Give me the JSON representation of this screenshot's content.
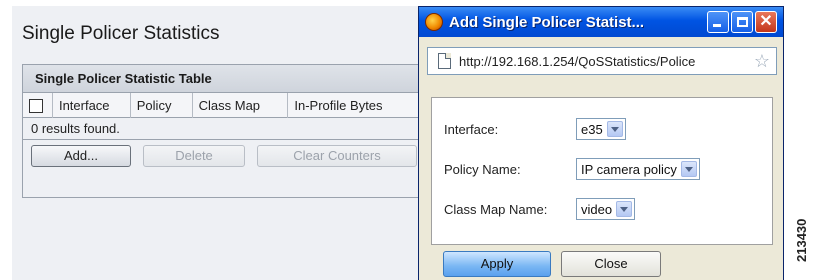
{
  "page": {
    "title": "Single Policer Statistics",
    "table": {
      "title": "Single Policer Statistic Table",
      "columns": [
        "Interface",
        "Policy",
        "Class Map",
        "In-Profile Bytes"
      ],
      "empty_message": "0 results found."
    },
    "buttons": {
      "add": "Add...",
      "delete": "Delete",
      "clear_counters": "Clear Counters"
    }
  },
  "popup": {
    "window_title": "Add Single Policer Statist...",
    "url": "http://192.168.1.254/QoSStatistics/Police",
    "fields": {
      "interface": {
        "label": "Interface:",
        "value": "e35"
      },
      "policy_name": {
        "label": "Policy Name:",
        "value": "IP camera policy"
      },
      "class_map_name": {
        "label": "Class Map Name:",
        "value": "video"
      }
    },
    "buttons": {
      "apply": "Apply",
      "close": "Close"
    }
  },
  "figure_id": "213430"
}
